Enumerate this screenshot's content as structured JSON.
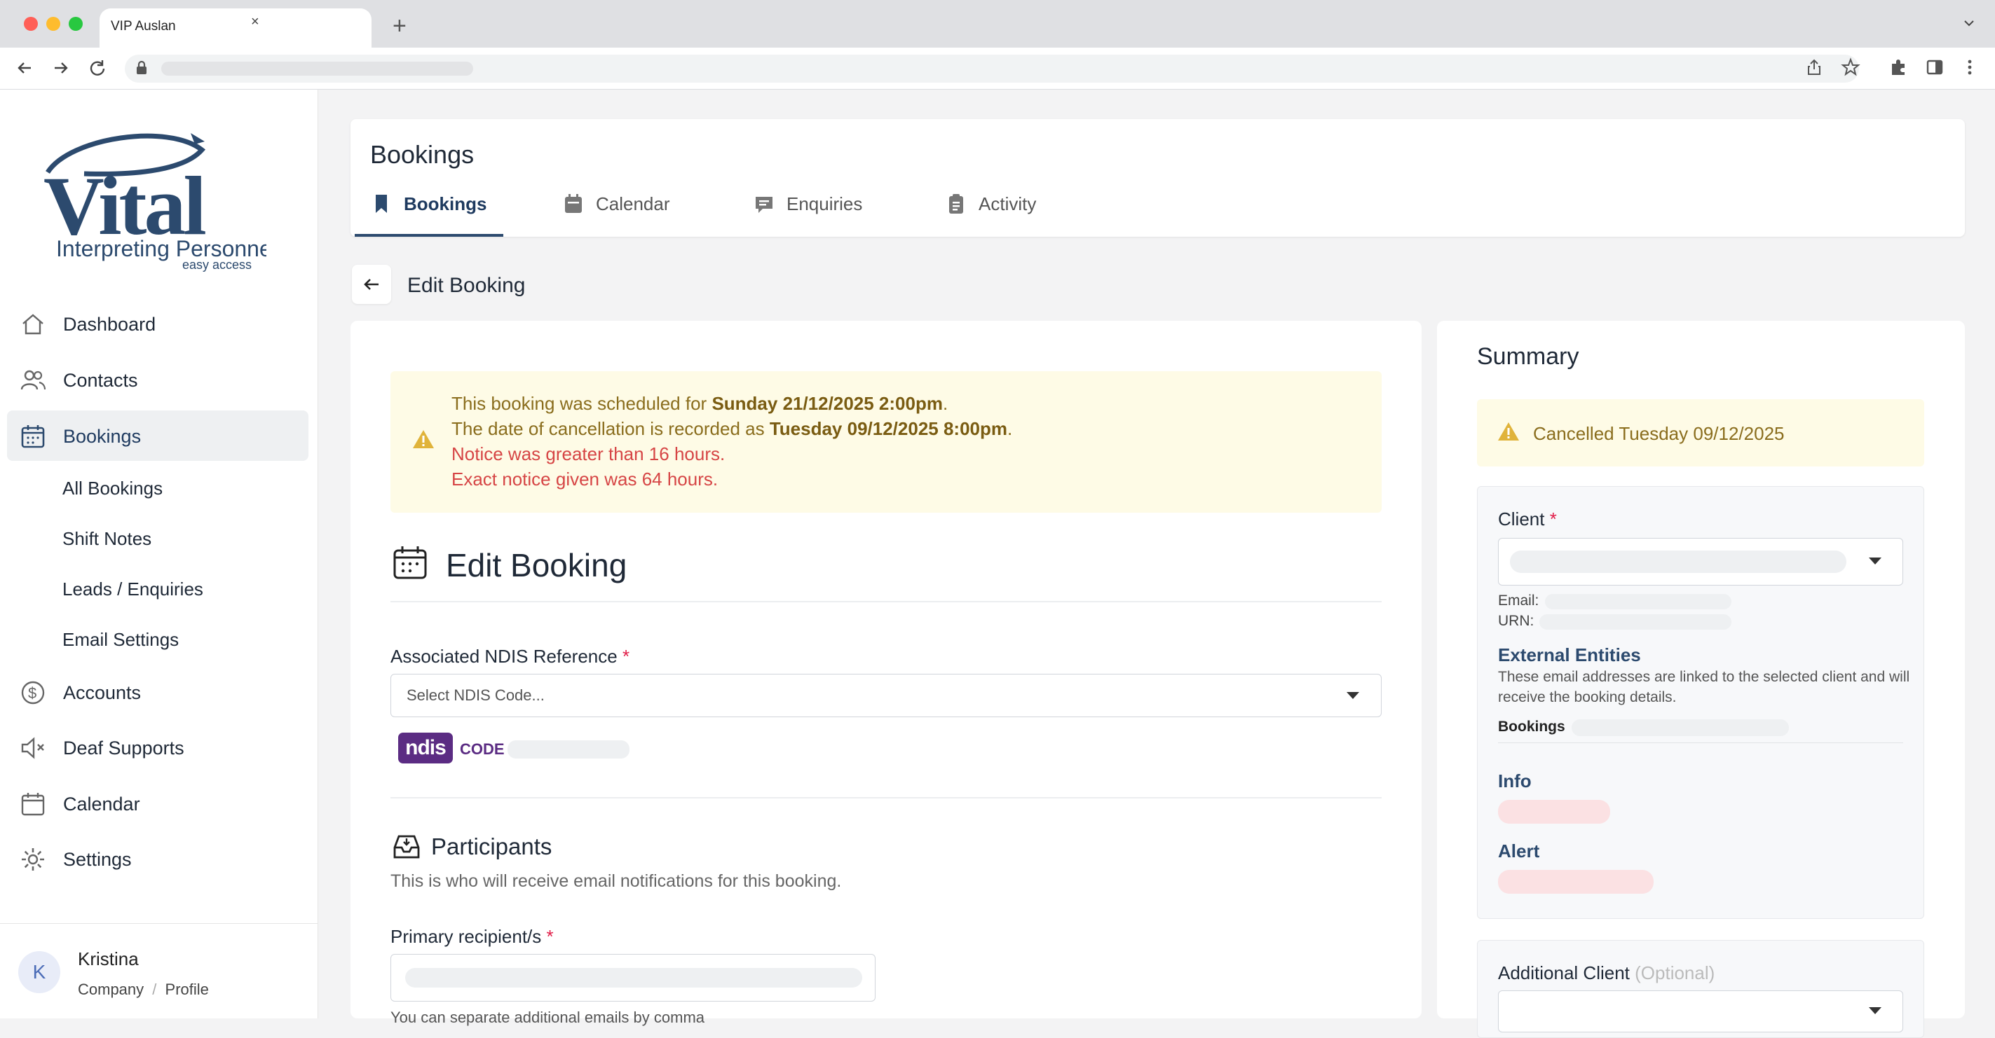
{
  "browser": {
    "tab_title": "VIP Auslan",
    "tab_close": "×",
    "new_tab": "+"
  },
  "logo": {
    "wordmark": "Vital",
    "line1": "Interpreting Personnel",
    "line2": "easy access"
  },
  "sidebar": {
    "items": [
      {
        "label": "Dashboard",
        "icon": "home-icon"
      },
      {
        "label": "Contacts",
        "icon": "users-icon"
      },
      {
        "label": "Bookings",
        "icon": "calendar-grid-icon"
      },
      {
        "label": "Accounts",
        "icon": "dollar-icon"
      },
      {
        "label": "Deaf Supports",
        "icon": "speaker-muted-icon"
      },
      {
        "label": "Calendar",
        "icon": "calendar-icon"
      },
      {
        "label": "Settings",
        "icon": "gear-icon"
      }
    ],
    "subitems": [
      "All Bookings",
      "Shift Notes",
      "Leads / Enquiries",
      "Email Settings"
    ],
    "user": {
      "initial": "K",
      "name": "Kristina",
      "company": "Company",
      "sep": "/",
      "profile": "Profile"
    }
  },
  "header": {
    "title": "Bookings",
    "tabs": [
      "Bookings",
      "Calendar",
      "Enquiries",
      "Activity"
    ]
  },
  "edit_header": "Edit Booking",
  "alert": {
    "l1_prefix": "This booking was scheduled for ",
    "l1_bold": "Sunday 21/12/2025 2:00pm",
    "l1_suffix": ".",
    "l2_prefix": "The date of cancellation is recorded as ",
    "l2_bold": "Tuesday 09/12/2025 8:00pm",
    "l2_suffix": ".",
    "l3": "Notice was greater than 16 hours.",
    "l4": "Exact notice given was 64 hours."
  },
  "form": {
    "title": "Edit Booking",
    "ndis_label": "Associated NDIS Reference",
    "required_mark": "*",
    "ndis_placeholder": "Select NDIS Code...",
    "ndis_badge": "ndis",
    "ndis_code_label": "CODE",
    "participants_title": "Participants",
    "participants_desc": "This is who will receive email notifications for this booking.",
    "primary_label": "Primary recipient/s",
    "hint": "You can separate additional emails by comma"
  },
  "summary": {
    "title": "Summary",
    "cancel_text": "Cancelled Tuesday 09/12/2025",
    "client_label": "Client",
    "email_label": "Email:",
    "urn_label": "URN:",
    "ext_title": "External Entities",
    "ext_desc": "These email addresses are linked to the selected client and will receive the booking details.",
    "bookings_label": "Bookings",
    "info_label": "Info",
    "alert_label": "Alert",
    "additional_label": "Additional Client",
    "optional": "(Optional)"
  },
  "colors": {
    "brand_navy": "#2c4a6e",
    "warning_bg": "#fefbe6",
    "warning_text": "#8a6d1d",
    "danger_text": "#d64545",
    "ndis_purple": "#5b2c83"
  }
}
